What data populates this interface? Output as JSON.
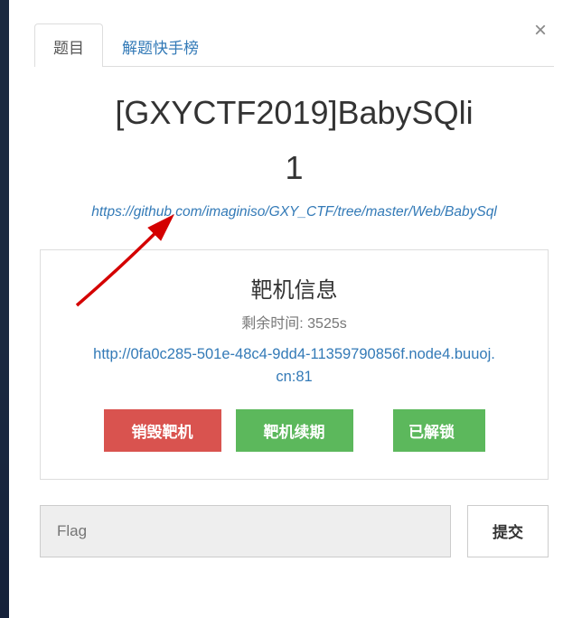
{
  "tabs": {
    "active": "题目",
    "secondary": "解题快手榜"
  },
  "title": {
    "main": "[GXYCTF2019]BabySQli",
    "suffix": "1"
  },
  "hint_url": "https://github.com/imaginiso/GXY_CTF/tree/master/Web/BabySql",
  "panel": {
    "heading": "靶机信息",
    "time_label": "剩余时间: 3525s",
    "instance_url": "http://0fa0c285-501e-48c4-9dd4-11359790856f.node4.buuoj.cn:81",
    "destroy_label": "销毁靶机",
    "renew_label": "靶机续期",
    "unlock_label": "已解锁"
  },
  "flag": {
    "placeholder": "Flag",
    "submit_label": "提交"
  }
}
